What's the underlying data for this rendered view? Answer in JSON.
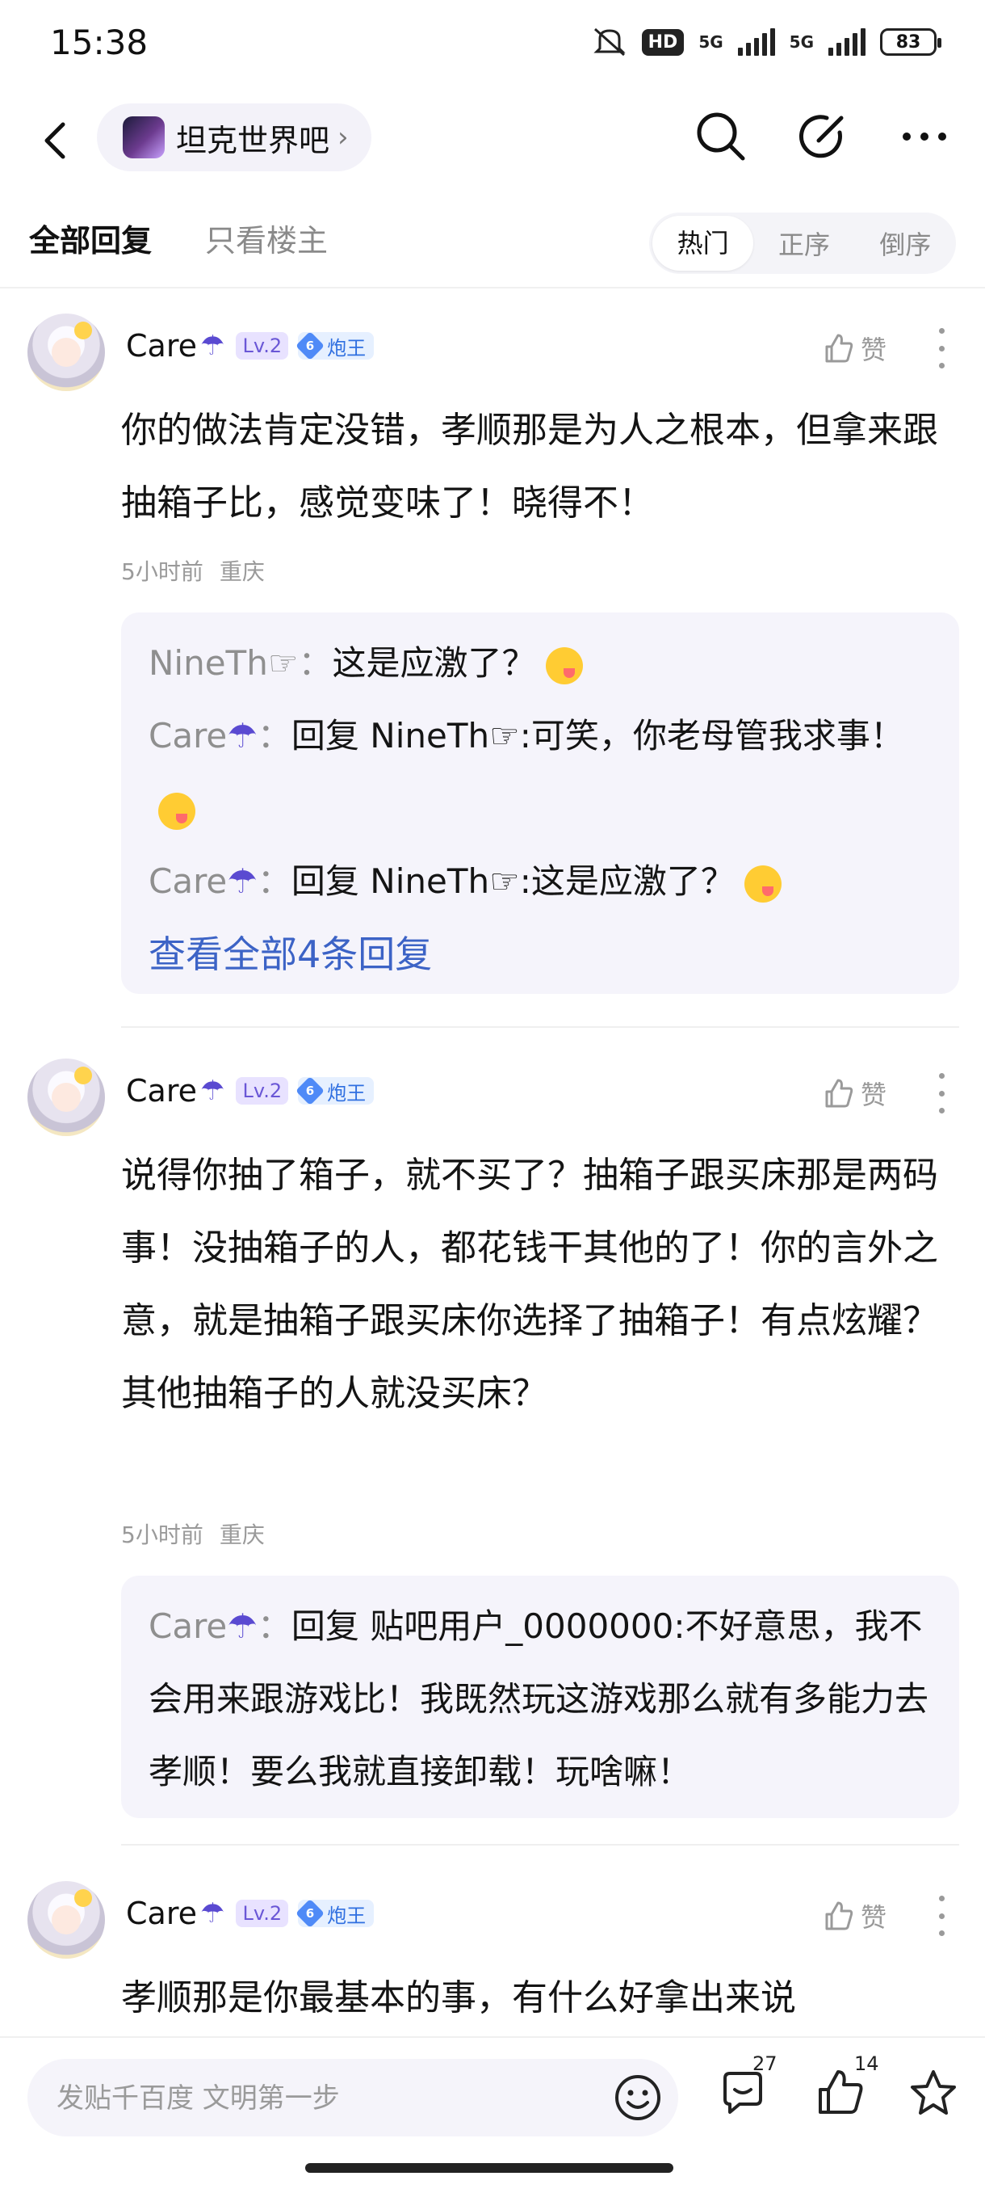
{
  "status": {
    "time": "15:38",
    "hd": "HD",
    "net1": "5G",
    "net2": "5G",
    "battery": "83"
  },
  "nav": {
    "forum": "坦克世界吧"
  },
  "tabs": {
    "all": "全部回复",
    "op_only": "只看楼主",
    "sort": [
      "热门",
      "正序",
      "倒序"
    ]
  },
  "comments": [
    {
      "user": "Care",
      "level": "Lv.2",
      "rank_num": "6",
      "rank_title": "炮王",
      "like_label": "赞",
      "text": "你的做法肯定没错，孝顺那是为人之根本，但拿来跟抽箱子比，感觉变味了！晓得不！",
      "time": "5小时前",
      "location": "重庆",
      "replies": [
        {
          "name": "NineTh☞",
          "sep": "：",
          "prefix": "",
          "target": "",
          "content": "这是应激了？"
        },
        {
          "name": "Care",
          "sep": "：",
          "prefix": "回复 ",
          "target": "NineTh☞",
          "content": ":可笑，你老母管我求事！"
        },
        {
          "name": "Care",
          "sep": "：",
          "prefix": "回复 ",
          "target": "NineTh☞",
          "content": ":这是应激了？"
        }
      ],
      "view_all": "查看全部4条回复"
    },
    {
      "user": "Care",
      "level": "Lv.2",
      "rank_num": "6",
      "rank_title": "炮王",
      "like_label": "赞",
      "text": "说得你抽了箱子，就不买了？抽箱子跟买床那是两码事！没抽箱子的人，都花钱干其他的了！你的言外之意，就是抽箱子跟买床你选择了抽箱子！有点炫耀？其他抽箱子的人就没买床？",
      "time": "5小时前",
      "location": "重庆",
      "replies": [
        {
          "name": "Care",
          "sep": "：",
          "prefix": "回复 ",
          "target": "贴吧用户_0000000",
          "content": ":不好意思，我不会用来跟游戏比！我既然玩这游戏那么就有多能力去孝顺！要么我就直接卸载！玩啥嘛！"
        }
      ]
    },
    {
      "user": "Care",
      "level": "Lv.2",
      "rank_num": "6",
      "rank_title": "炮王",
      "like_label": "赞",
      "text": "孝顺那是你最基本的事，有什么好拿出来说"
    }
  ],
  "bottom": {
    "placeholder": "发贴千百度 文明第一步",
    "comment_count": "27",
    "like_count": "14"
  },
  "colors": {
    "link": "#3c63c6",
    "reply_bg": "#f5f4fb",
    "level_bg": "#e8e2ff",
    "rank": "#4f8af7"
  },
  "icons": [
    "back-icon",
    "search-icon",
    "edit-share-icon",
    "more-icon",
    "thumb-up-icon",
    "emoji-icon",
    "comment-icon",
    "star-icon"
  ]
}
